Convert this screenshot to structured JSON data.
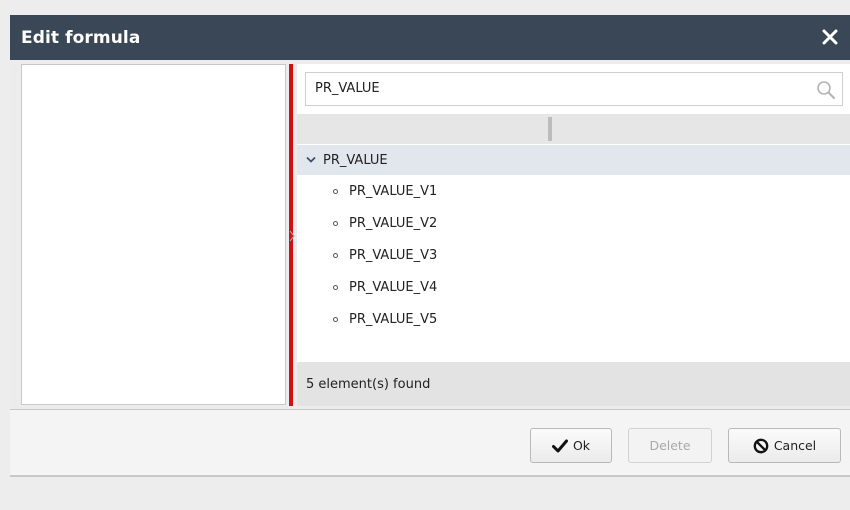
{
  "dialog": {
    "title": "Edit formula"
  },
  "search": {
    "value": "PR_VALUE"
  },
  "tree": {
    "root_label": "PR_VALUE",
    "items": [
      {
        "label": "PR_VALUE_V1"
      },
      {
        "label": "PR_VALUE_V2"
      },
      {
        "label": "PR_VALUE_V3"
      },
      {
        "label": "PR_VALUE_V4"
      },
      {
        "label": "PR_VALUE_V5"
      }
    ]
  },
  "status": {
    "text": "5 element(s) found"
  },
  "buttons": {
    "ok_label": "Ok",
    "delete_label": "Delete",
    "cancel_label": "Cancel"
  },
  "icons": {
    "close": "close-icon",
    "search": "search-icon",
    "expand": "chevron-down-icon",
    "ok": "checkmark-icon",
    "cancel": "prohibited-icon"
  },
  "colors": {
    "titlebar": "#3a4757",
    "splitter": "#d20f14",
    "selected_row": "#e2e7ee"
  }
}
